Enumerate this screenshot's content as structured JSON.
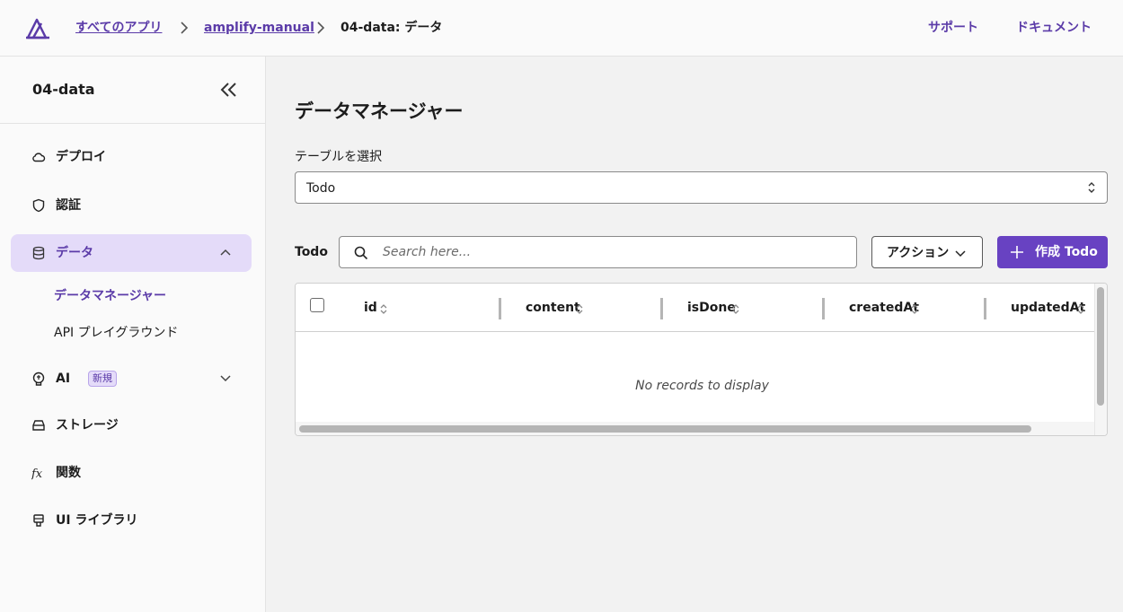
{
  "header": {
    "breadcrumbs": [
      "すべてのアプリ",
      "amplify-manual",
      "04-data: データ"
    ],
    "links": {
      "support": "サポート",
      "docs": "ドキュメント"
    }
  },
  "sidebar": {
    "title": "04-data",
    "items": [
      {
        "label": "デプロイ",
        "icon": "cloud-icon"
      },
      {
        "label": "認証",
        "icon": "shield-icon"
      },
      {
        "label": "データ",
        "icon": "database-icon"
      },
      {
        "label": "AI",
        "icon": "brain-icon",
        "badge": "新規"
      },
      {
        "label": "ストレージ",
        "icon": "storage-icon"
      },
      {
        "label": "関数",
        "icon": "function-icon"
      },
      {
        "label": "UI ライブラリ",
        "icon": "ui-library-icon"
      }
    ],
    "data_subitems": [
      "データマネージャー",
      "API プレイグラウンド"
    ]
  },
  "main": {
    "title": "データマネージャー",
    "table_select": {
      "label": "テーブルを選択",
      "value": "Todo"
    },
    "toolbar": {
      "table_name": "Todo",
      "search_placeholder": "Search here...",
      "actions_label": "アクション",
      "create_label": "作成 Todo"
    },
    "table": {
      "columns": [
        "id",
        "content",
        "isDone",
        "createdAt",
        "updatedAt"
      ],
      "empty_text": "No records to display"
    }
  },
  "colors": {
    "accent": "#6842c2",
    "link": "#5b3ba8",
    "active_bg": "#e4dbf9"
  }
}
